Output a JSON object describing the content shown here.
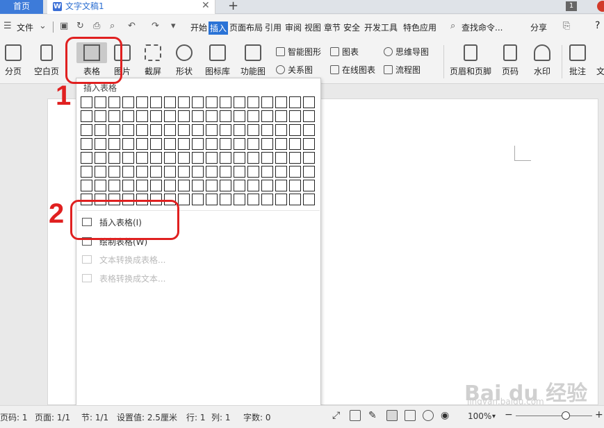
{
  "tabbar": {
    "home": "首页",
    "doc_icon": "W",
    "doc_title": "文字文稿1",
    "close": "✕",
    "new_tab": "+",
    "window_badge": "1"
  },
  "menu": {
    "file": "文件",
    "tabs": [
      "开始",
      "插入",
      "页面布局",
      "引用",
      "审阅",
      "视图",
      "章节",
      "安全",
      "开发工具",
      "特色应用"
    ],
    "active_tab": "插入",
    "search": "查找命令...",
    "share": "分享",
    "help": "?"
  },
  "ribbon": {
    "page_break": "分页",
    "blank_page": "空白页",
    "table": "表格",
    "picture": "图片",
    "screenshot": "截屏",
    "shapes": "形状",
    "icon_library": "图标库",
    "function_chart": "功能图",
    "smart_shape": "智能图形",
    "chart": "图表",
    "relation_chart": "关系图",
    "online_chart": "在线图表",
    "mind_map": "思维导图",
    "flowchart": "流程图",
    "header_footer": "页眉和页脚",
    "page_number": "页码",
    "watermark": "水印",
    "comment": "批注",
    "more": "文"
  },
  "dropdown": {
    "title": "插入表格",
    "grid_rows": 8,
    "grid_cols": 17,
    "items": [
      {
        "label": "插入表格(I)",
        "enabled": true
      },
      {
        "label": "绘制表格(W)",
        "enabled": true
      },
      {
        "label": "文本转换成表格...",
        "enabled": false
      },
      {
        "label": "表格转换成文本...",
        "enabled": false
      }
    ]
  },
  "annotations": {
    "step1": "1",
    "step2": "2"
  },
  "statusbar": {
    "page_number": "页码: 1",
    "page": "页面: 1/1",
    "section": "节: 1/1",
    "setting": "设置值: 2.5厘米",
    "row": "行: 1",
    "col": "列: 1",
    "word_count": "字数: 0",
    "zoom": "100%",
    "zoom_level": 0.65
  },
  "watermark": {
    "text": "Bai du 经验",
    "sub": "jingyan.baidu.com"
  },
  "colors": {
    "accent": "#2a73d6",
    "annotation": "#e02020"
  }
}
